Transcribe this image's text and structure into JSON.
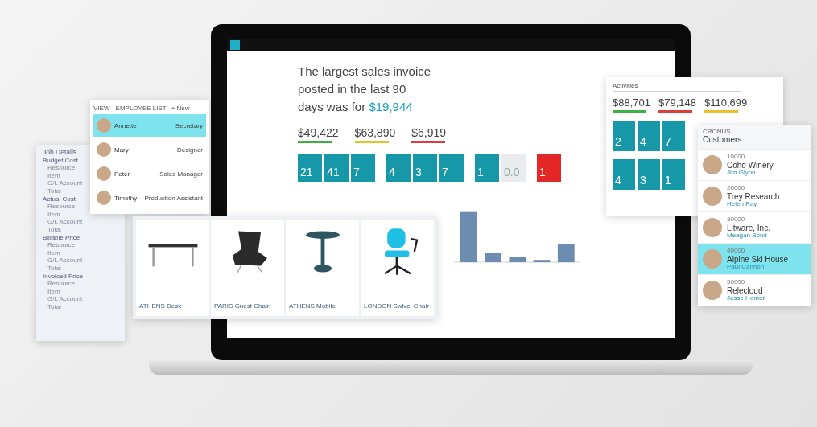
{
  "laptop": {
    "headline": "The largest sales invoice posted in the last 90 days was for",
    "headline_amount": "$19,944",
    "kpis": [
      {
        "value": "$49,422",
        "color": "#3cb043"
      },
      {
        "value": "$63,890",
        "color": "#e8c22c"
      },
      {
        "value": "$6,919",
        "color": "#e03c3c"
      }
    ],
    "tile_groups": [
      [
        {
          "kind": "count",
          "value": "21"
        },
        {
          "kind": "count",
          "value": "41"
        },
        {
          "kind": "count",
          "value": "7"
        }
      ],
      [
        {
          "kind": "count",
          "value": "4"
        },
        {
          "kind": "count",
          "value": "3"
        },
        {
          "kind": "count",
          "value": "7"
        }
      ],
      [
        {
          "kind": "count",
          "value": "1"
        },
        {
          "kind": "ratio",
          "value": "0.0"
        }
      ],
      [
        {
          "kind": "alert",
          "value": "1"
        }
      ]
    ]
  },
  "activities": {
    "title": "Activities",
    "kpis": [
      {
        "value": "$88,701",
        "color": "#3cb043"
      },
      {
        "value": "$79,148",
        "color": "#e03c3c"
      },
      {
        "value": "$110,699",
        "color": "#e8c22c"
      }
    ],
    "tile_rows": [
      [
        "2",
        "4",
        "7"
      ],
      [
        "4",
        "3",
        "1"
      ]
    ]
  },
  "customers": {
    "company": "CRONUS",
    "title": "Customers",
    "rows": [
      {
        "number": "10000",
        "name": "Coho Winery",
        "contact": "Jim Glynn",
        "selected": false
      },
      {
        "number": "20000",
        "name": "Trey Research",
        "contact": "Helen Ray",
        "selected": false
      },
      {
        "number": "30000",
        "name": "Litware, Inc.",
        "contact": "Meagan Bond",
        "selected": false
      },
      {
        "number": "40000",
        "name": "Alpine Ski House",
        "contact": "Paul Cannon",
        "selected": true
      },
      {
        "number": "50000",
        "name": "Relecloud",
        "contact": "Jesse Homer",
        "selected": false
      }
    ]
  },
  "employees": {
    "title": "VIEW - EMPLOYEE LIST",
    "new_button": "+ New",
    "rows": [
      {
        "name": "Annette",
        "role": "Secretary",
        "selected": true
      },
      {
        "name": "Mary",
        "role": "Designer",
        "selected": false
      },
      {
        "name": "Peter",
        "role": "Sales Manager",
        "selected": false
      },
      {
        "name": "Timothy",
        "role": "Production Assistant",
        "selected": false
      }
    ]
  },
  "job_details": {
    "title": "Job Details",
    "sections": [
      {
        "title": "Budget Cost",
        "rows": [
          "Resource",
          "Item",
          "G/L Account",
          "Total"
        ]
      },
      {
        "title": "Actual Cost",
        "rows": [
          "Resource",
          "Item",
          "G/L Account",
          "Total"
        ]
      },
      {
        "title": "Billable Price",
        "rows": [
          "Resource",
          "Item",
          "G/L Account",
          "Total"
        ]
      },
      {
        "title": "Invoiced Price",
        "rows": [
          "Resource",
          "Item",
          "G/L Account",
          "Total"
        ]
      }
    ]
  },
  "products": [
    {
      "kind": "desk",
      "name": "ATHENS Desk"
    },
    {
      "kind": "armchair",
      "name": "PARIS Guest Chair"
    },
    {
      "kind": "pedestal-table",
      "name": "ATHENS Mobile"
    },
    {
      "kind": "office-chair",
      "name": "LONDON Swivel Chair"
    }
  ]
}
